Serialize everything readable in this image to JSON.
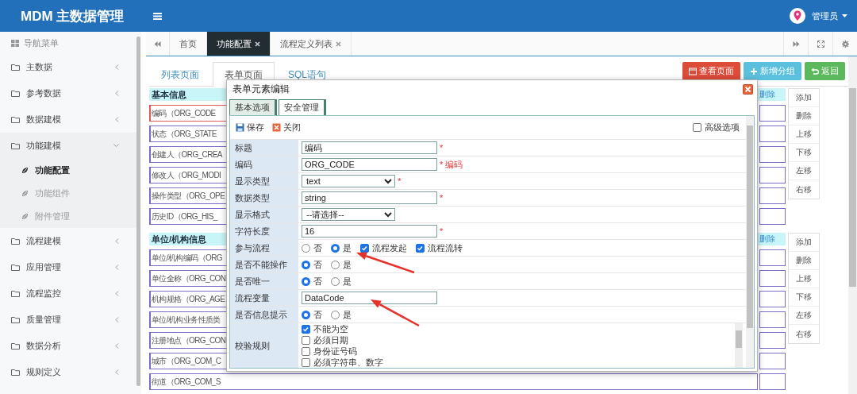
{
  "header": {
    "title": "MDM 主数据管理",
    "user": "管理员"
  },
  "sidebar": {
    "heading": "导航菜单",
    "items": [
      {
        "label": "主数据",
        "expanded": false
      },
      {
        "label": "参考数据",
        "expanded": false
      },
      {
        "label": "数据建模",
        "expanded": false
      },
      {
        "label": "功能建模",
        "expanded": true,
        "children": [
          {
            "label": "功能配置",
            "selected": true
          },
          {
            "label": "功能组件",
            "selected": false
          },
          {
            "label": "附件管理",
            "selected": false
          }
        ]
      },
      {
        "label": "流程建模",
        "expanded": false
      },
      {
        "label": "应用管理",
        "expanded": false
      },
      {
        "label": "流程监控",
        "expanded": false
      },
      {
        "label": "质量管理",
        "expanded": false
      },
      {
        "label": "数据分析",
        "expanded": false
      },
      {
        "label": "规则定义",
        "expanded": false
      }
    ]
  },
  "tabs": [
    {
      "label": "首页",
      "selected": false,
      "closable": false
    },
    {
      "label": "功能配置",
      "selected": true,
      "closable": true
    },
    {
      "label": "流程定义列表",
      "selected": false,
      "closable": true
    }
  ],
  "page_tabs": [
    {
      "label": "列表页面",
      "selected": false
    },
    {
      "label": "表单页面",
      "selected": true
    },
    {
      "label": "SQL语句",
      "selected": false
    }
  ],
  "actions": [
    {
      "label": "查看页面",
      "kind": "danger"
    },
    {
      "label": "新增分组",
      "kind": "info"
    },
    {
      "label": "返回",
      "kind": "success"
    }
  ],
  "groups": [
    {
      "title": "基本信息",
      "column_header": "删除",
      "fields": [
        {
          "label": "编码（ORG_CODE",
          "selected": true
        },
        {
          "label": "状态（ORG_STATE",
          "selected": false
        },
        {
          "label": "创建人（ORG_CREA",
          "selected": false
        },
        {
          "label": "修改人（ORG_MODI",
          "selected": false
        },
        {
          "label": "操作类型（ORG_OPE",
          "selected": false
        },
        {
          "label": "历史ID（ORG_HIS_",
          "selected": false
        }
      ],
      "buttons": [
        "添加",
        "删除",
        "上移",
        "下移",
        "左移",
        "右移"
      ]
    },
    {
      "title": "单位/机构信息",
      "column_header": "删除",
      "fields": [
        {
          "label": "单位/机构编码（ORG",
          "selected": false
        },
        {
          "label": "单位全称（ORG_CON",
          "selected": false
        },
        {
          "label": "机构规格（ORG_AGE",
          "selected": false
        },
        {
          "label": "单位/机构业务性质类",
          "selected": false
        },
        {
          "label": "注册地点（ORG_CON",
          "selected": false
        },
        {
          "label": "城市（ORG_COM_C",
          "selected": false
        },
        {
          "label": "街道（ORG_COM_S",
          "selected": false
        }
      ],
      "buttons": [
        "添加",
        "删除",
        "上移",
        "下移",
        "左移",
        "右移"
      ]
    }
  ],
  "dialog": {
    "title": "表单元素编辑",
    "tabs": [
      {
        "label": "基本选项",
        "selected": true
      },
      {
        "label": "安全管理",
        "selected": false
      }
    ],
    "toolbar": [
      {
        "label": "保存",
        "kind": "save"
      },
      {
        "label": "关闭",
        "kind": "close"
      }
    ],
    "advanced": {
      "label": "高级选项",
      "checked": false
    },
    "rows": [
      {
        "label": "标题",
        "kind": "text",
        "value": "编码",
        "mark": "*"
      },
      {
        "label": "编码",
        "kind": "text",
        "value": "ORG_CODE",
        "mark": "*",
        "note": "编码"
      },
      {
        "label": "显示类型",
        "kind": "select",
        "value": "text",
        "mark": "*"
      },
      {
        "label": "数据类型",
        "kind": "text",
        "value": "string",
        "mark": "*"
      },
      {
        "label": "显示格式",
        "kind": "select",
        "value": "--请选择--"
      },
      {
        "label": "字符长度",
        "kind": "text",
        "value": "16",
        "mark": "*"
      },
      {
        "label": "参与流程",
        "kind": "radio",
        "options": [
          {
            "label": "否",
            "selected": false
          },
          {
            "label": "是",
            "selected": true
          }
        ],
        "checks": [
          {
            "label": "流程发起",
            "checked": true
          },
          {
            "label": "流程流转",
            "checked": true
          }
        ]
      },
      {
        "label": "是否不能操作",
        "kind": "radio",
        "options": [
          {
            "label": "否",
            "selected": true
          },
          {
            "label": "是",
            "selected": false
          }
        ]
      },
      {
        "label": "是否唯一",
        "kind": "radio",
        "options": [
          {
            "label": "否",
            "selected": true
          },
          {
            "label": "是",
            "selected": false
          }
        ]
      },
      {
        "label": "流程变量",
        "kind": "text",
        "value": "DataCode"
      },
      {
        "label": "是否信息提示",
        "kind": "radio",
        "options": [
          {
            "label": "否",
            "selected": true
          },
          {
            "label": "是",
            "selected": false
          }
        ]
      },
      {
        "label": "校验规则",
        "kind": "checklist",
        "checks": [
          {
            "label": "不能为空",
            "checked": true
          },
          {
            "label": "必须日期",
            "checked": false
          },
          {
            "label": "身份证号码",
            "checked": false
          },
          {
            "label": "必须字符串、数字",
            "checked": false
          }
        ]
      }
    ]
  }
}
